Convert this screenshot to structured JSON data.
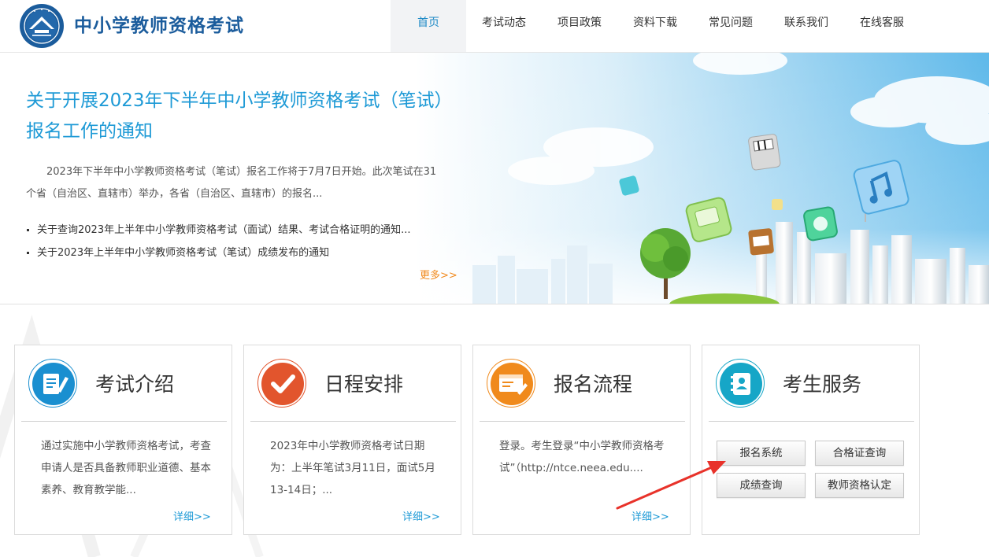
{
  "header": {
    "site_title": "中小学教师资格考试",
    "nav": [
      {
        "label": "首页",
        "active": true
      },
      {
        "label": "考试动态",
        "active": false
      },
      {
        "label": "项目政策",
        "active": false
      },
      {
        "label": "资料下载",
        "active": false
      },
      {
        "label": "常见问题",
        "active": false
      },
      {
        "label": "联系我们",
        "active": false
      },
      {
        "label": "在线客服",
        "active": false
      }
    ]
  },
  "banner": {
    "headline": "关于开展2023年下半年中小学教师资格考试（笔试）报名工作的通知",
    "summary": "2023年下半年中小学教师资格考试（笔试）报名工作将于7月7日开始。此次笔试在31个省（自治区、直辖市）举办，各省（自治区、直辖市）的报名...",
    "news": [
      "关于查询2023年上半年中小学教师资格考试（面试）结果、考试合格证明的通知...",
      "关于2023年上半年中小学教师资格考试（笔试）成绩发布的通知"
    ],
    "more_label": "更多>>"
  },
  "cards": [
    {
      "title": "考试介绍",
      "icon": "document-edit-icon",
      "text": "通过实施中小学教师资格考试，考查申请人是否具备教师职业道德、基本素养、教育教学能...",
      "more": "详细>>",
      "accent": "#1a8fd0"
    },
    {
      "title": "日程安排",
      "icon": "checkmark-icon",
      "text": "2023年中小学教师资格考试日期为：上半年笔试3月11日，面试5月13-14日；...",
      "more": "详细>>",
      "accent": "#e2552d"
    },
    {
      "title": "报名流程",
      "icon": "web-form-icon",
      "text": "登录。考生登录“中小学教师资格考试”（http://ntce.neea.edu....",
      "more": "详细>>",
      "accent": "#f08a1c"
    },
    {
      "title": "考生服务",
      "icon": "contact-book-icon",
      "accent": "#16a6c7",
      "buttons": [
        "报名系统",
        "合格证查询",
        "成绩查询",
        "教师资格认定"
      ]
    }
  ],
  "colors": {
    "brand": "#1b5c9c",
    "link": "#1e9ad6",
    "more": "#f18a1e",
    "annotation_arrow": "#e8322a"
  }
}
